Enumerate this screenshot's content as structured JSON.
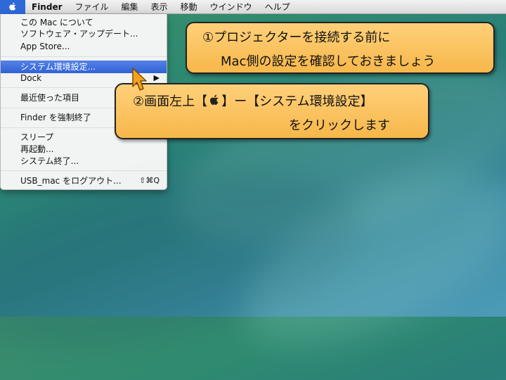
{
  "menubar": {
    "items": [
      "Finder",
      "ファイル",
      "編集",
      "表示",
      "移動",
      "ウインドウ",
      "ヘルプ"
    ]
  },
  "apple_menu": {
    "items": [
      "この Mac について",
      "ソフトウェア・アップデート...",
      "App Store...",
      "システム環境設定...",
      "Dock",
      "最近使った項目",
      "Finder を強制終了",
      "スリープ",
      "再起動...",
      "システム終了...",
      "USB_mac をログアウト..."
    ],
    "selected": "システム環境設定...",
    "logout_shortcut": "⇧⌘Q",
    "submenu_arrow": "▶"
  },
  "callout1": {
    "line1": "①プロジェクターを接続する前に",
    "line2": "Mac側の設定を確認しておきましょう"
  },
  "callout2": {
    "line1_prefix": "②画面左上【",
    "line1_suffix": "】ー【システム環境設定】",
    "line2": "をクリックします"
  },
  "colors": {
    "selection": "#2f62d6",
    "callout_fill": "#f7b74a",
    "apple_highlight": "#2f68d8"
  }
}
